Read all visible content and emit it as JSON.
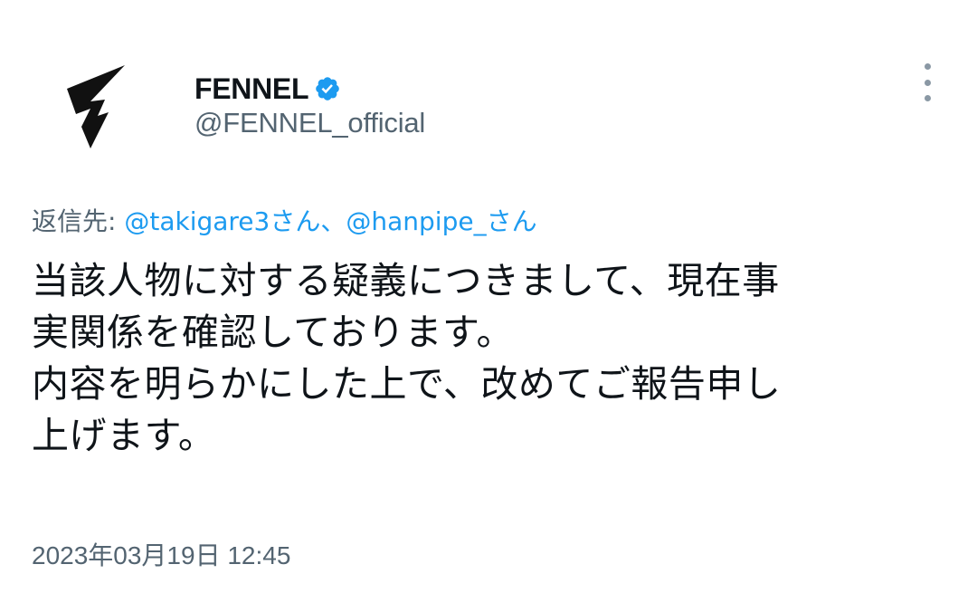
{
  "author": {
    "display_name": "FENNEL",
    "handle": "@FENNEL_official",
    "verified": true,
    "avatar_icon": "fennel-logo-icon"
  },
  "menu": {
    "icon": "more-options-icon"
  },
  "reply": {
    "prefix": "返信先: ",
    "mention1": "@takigare3",
    "suffix1": "さん、",
    "mention2": "@hanpipe_",
    "suffix2": "さん"
  },
  "body": {
    "lines": [
      "当該人物に対する疑義につきまして、現在事",
      "実関係を確認しております。",
      "内容を明らかにした上で、改めてご報告申し",
      "上げます。"
    ]
  },
  "meta": {
    "timestamp": "2023年03月19日 12:45"
  },
  "colors": {
    "text": "#0f1419",
    "secondary": "#536471",
    "accent": "#1d9bf0",
    "background": "#ffffff"
  }
}
